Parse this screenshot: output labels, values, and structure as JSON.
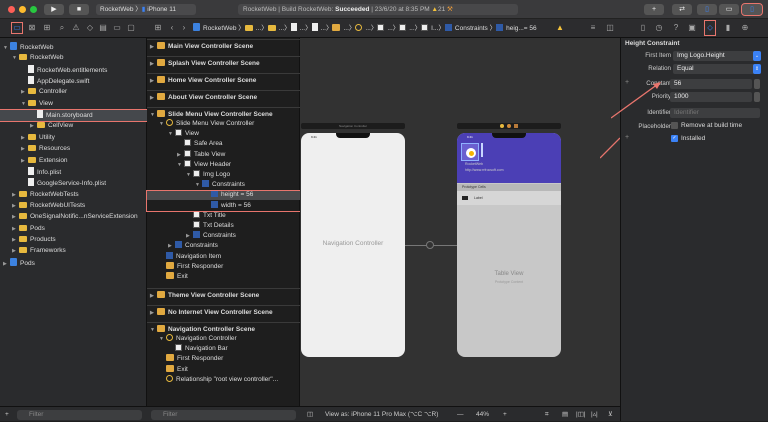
{
  "toolbar": {
    "scheme": "RocketWeb",
    "device": "iPhone 11",
    "status_prefix": "RocketWeb | Build RocketWeb: ",
    "status_result": "Succeeded",
    "status_time": " | 23/6/20 at 8:35 PM",
    "warnings": "21",
    "add": "+",
    "swap": "⇄"
  },
  "jump_bar": {
    "project": "RocketWeb",
    "ellipsis": "...",
    "constraints": "Constraints",
    "item": "heig...= 56"
  },
  "navigator": {
    "items": [
      {
        "label": "RocketWeb",
        "type": "project"
      },
      {
        "label": "RocketWeb",
        "type": "folder"
      },
      {
        "label": "RocketWeb.entitlements",
        "type": "file"
      },
      {
        "label": "AppDelegate.swift",
        "type": "file"
      },
      {
        "label": "Controller",
        "type": "folder"
      },
      {
        "label": "View",
        "type": "folder"
      },
      {
        "label": "Main.storyboard",
        "type": "file"
      },
      {
        "label": "CellView",
        "type": "folder"
      },
      {
        "label": "Utility",
        "type": "folder"
      },
      {
        "label": "Resources",
        "type": "folder"
      },
      {
        "label": "Extension",
        "type": "folder"
      },
      {
        "label": "Info.plist",
        "type": "file"
      },
      {
        "label": "GoogleService-Info.plist",
        "type": "file"
      },
      {
        "label": "RocketWebTests",
        "type": "folder"
      },
      {
        "label": "RocketWebUITests",
        "type": "folder"
      },
      {
        "label": "OneSignalNotific...nServiceExtension",
        "type": "folder"
      },
      {
        "label": "Pods",
        "type": "folder"
      },
      {
        "label": "Products",
        "type": "folder"
      },
      {
        "label": "Frameworks",
        "type": "folder"
      },
      {
        "label": "Pods",
        "type": "project"
      }
    ],
    "filter_placeholder": "Filter"
  },
  "outline": {
    "scenes": [
      "Main View Controller Scene",
      "Splash View Controller Scene",
      "Home View Controller Scene",
      "About View Controller Scene",
      "Slide Menu View Controller Scene",
      "Theme View Controller Scene",
      "No Internet View Controller Scene",
      "Navigation Controller Scene"
    ],
    "slide_menu_items": [
      "Slide Menu View Controller",
      "View",
      "Safe Area",
      "Table View",
      "View Header",
      "Img Logo",
      "Constraints",
      "height = 56",
      "width = 56",
      "Txt Title",
      "Txt Details",
      "Constraints",
      "Constraints",
      "Navigation Item",
      "First Responder",
      "Exit"
    ],
    "nav_items": [
      "Navigation Controller",
      "Navigation Bar",
      "First Responder",
      "Exit",
      "Relationship \"root view controller\"..."
    ],
    "filter_placeholder": "Filter"
  },
  "canvas": {
    "nav_title": "Navigation Controller",
    "nav_label": "Navigation Controller",
    "time": "9:41",
    "app_name": "RocketWeb",
    "url": "http://www.rrfrocsoft.com",
    "prototype_cells": "Prototype Cells",
    "cell_label": "Label",
    "table_view": "Table View",
    "prototype_content": "Prototype Content",
    "view_as": "View as: iPhone 11 Pro Max (⌥C ⌥R)",
    "zoom": "44%",
    "minus": "—",
    "plus": "+"
  },
  "inspector": {
    "title": "Height Constraint",
    "first_item_label": "First Item",
    "first_item": "Img Logo.Height",
    "relation_label": "Relation",
    "relation": "Equal",
    "constant_label": "Constant",
    "constant": "56",
    "priority_label": "Priority",
    "priority": "1000",
    "identifier_label": "Identifier",
    "identifier_placeholder": "Identifier",
    "placeholder_label": "Placeholder",
    "placeholder_option": "Remove at build time",
    "placeholder_checked": false,
    "installed": "Installed",
    "installed_checked": true
  },
  "colors": {
    "accent": "#3b82f6",
    "highlight": "#e8756d",
    "header_purple": "#4b3fb5",
    "folder": "#e7b93e"
  }
}
